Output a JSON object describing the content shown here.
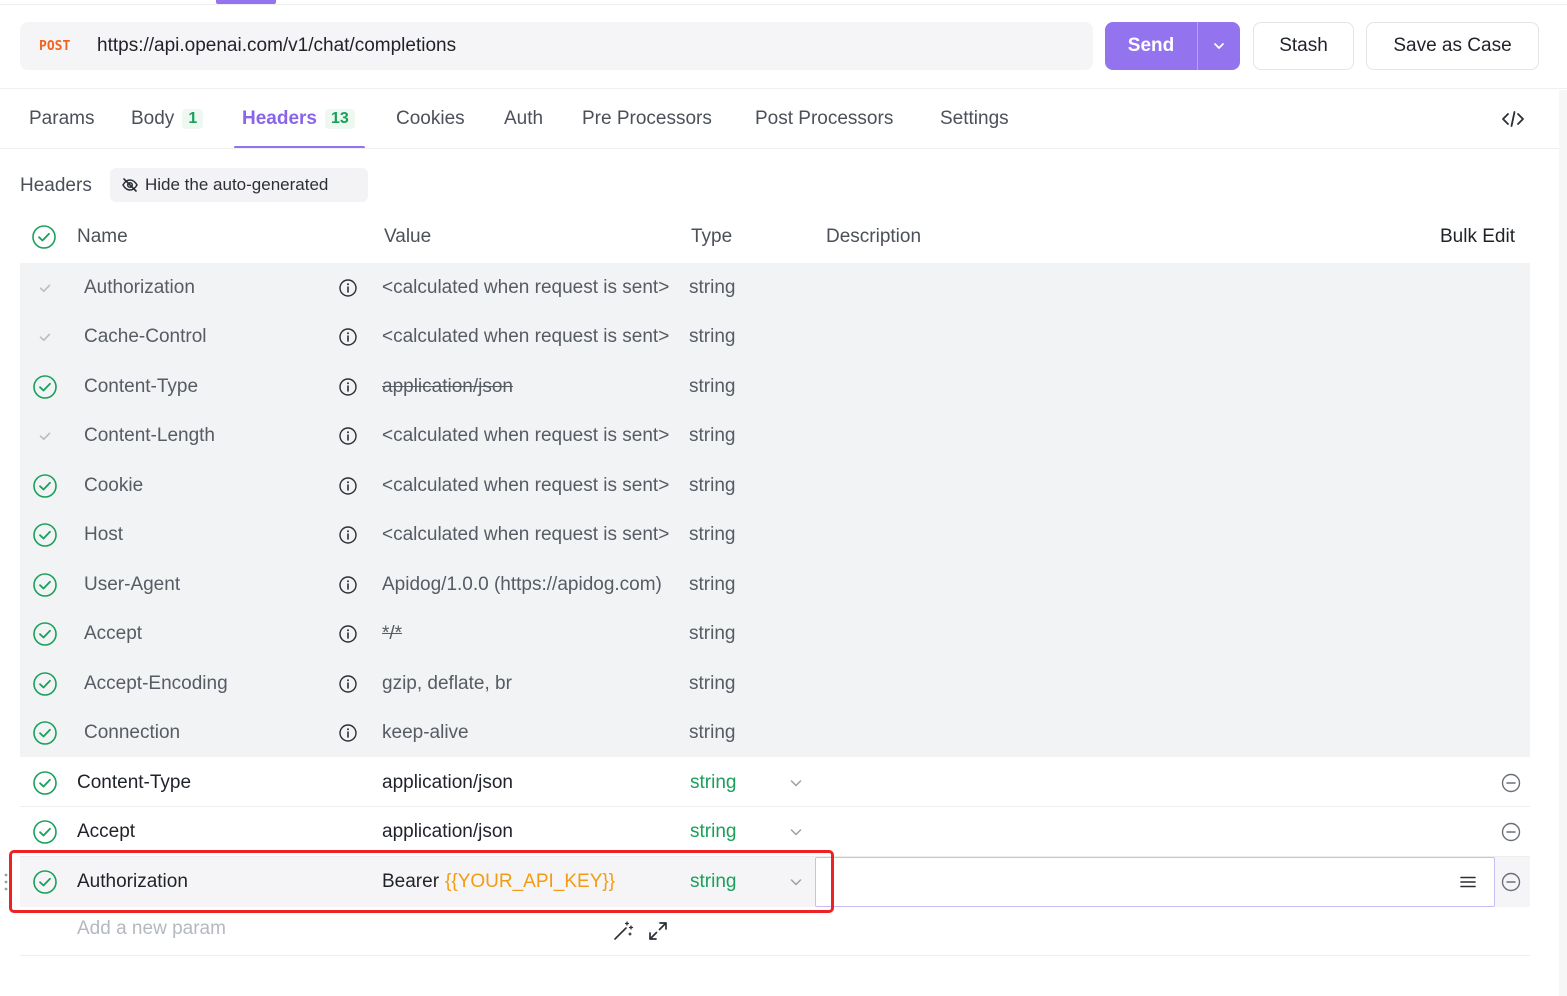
{
  "request": {
    "method": "POST",
    "url": "https://api.openai.com/v1/chat/completions"
  },
  "actions": {
    "send": "Send",
    "stash": "Stash",
    "save_as_case": "Save as Case"
  },
  "tabs": [
    {
      "label": "Params",
      "badge": ""
    },
    {
      "label": "Body",
      "badge": "1"
    },
    {
      "label": "Headers",
      "badge": "13"
    },
    {
      "label": "Cookies",
      "badge": ""
    },
    {
      "label": "Auth",
      "badge": ""
    },
    {
      "label": "Pre Processors",
      "badge": ""
    },
    {
      "label": "Post Processors",
      "badge": ""
    },
    {
      "label": "Settings",
      "badge": ""
    }
  ],
  "active_tab": "Headers",
  "headers_section": {
    "title": "Headers",
    "hide_auto_label": "Hide the auto-generated"
  },
  "columns": {
    "name": "Name",
    "value": "Value",
    "type": "Type",
    "description": "Description",
    "bulk_edit": "Bulk Edit"
  },
  "auto_rows": [
    {
      "name": "Authorization",
      "value": "<calculated when request is sent>",
      "type": "string",
      "enabled": false
    },
    {
      "name": "Cache-Control",
      "value": "<calculated when request is sent>",
      "type": "string",
      "enabled": false
    },
    {
      "name": "Content-Type",
      "value": "application/json",
      "type": "string",
      "enabled": true,
      "overridden": true
    },
    {
      "name": "Content-Length",
      "value": "<calculated when request is sent>",
      "type": "string",
      "enabled": false
    },
    {
      "name": "Cookie",
      "value": "<calculated when request is sent>",
      "type": "string",
      "enabled": true
    },
    {
      "name": "Host",
      "value": "<calculated when request is sent>",
      "type": "string",
      "enabled": true
    },
    {
      "name": "User-Agent",
      "value": "Apidog/1.0.0 (https://apidog.com)",
      "type": "string",
      "enabled": true
    },
    {
      "name": "Accept",
      "value": "*/*",
      "type": "string",
      "enabled": true,
      "overridden": true
    },
    {
      "name": "Accept-Encoding",
      "value": "gzip, deflate, br",
      "type": "string",
      "enabled": true
    },
    {
      "name": "Connection",
      "value": "keep-alive",
      "type": "string",
      "enabled": true
    }
  ],
  "custom_rows": [
    {
      "name": "Content-Type",
      "value": "application/json",
      "value_var": "",
      "type": "string"
    },
    {
      "name": "Accept",
      "value": "application/json",
      "value_var": "",
      "type": "string"
    },
    {
      "name": "Authorization",
      "value": "Bearer",
      "value_var": "{{YOUR_API_KEY}}",
      "type": "string"
    }
  ],
  "add_param_placeholder": "Add a new param",
  "colors": {
    "accent": "#9373ee",
    "method_post": "#f1631c",
    "type_green": "#1aa05a",
    "variable_orange": "#f39c12",
    "highlight_red": "#ee2222"
  }
}
